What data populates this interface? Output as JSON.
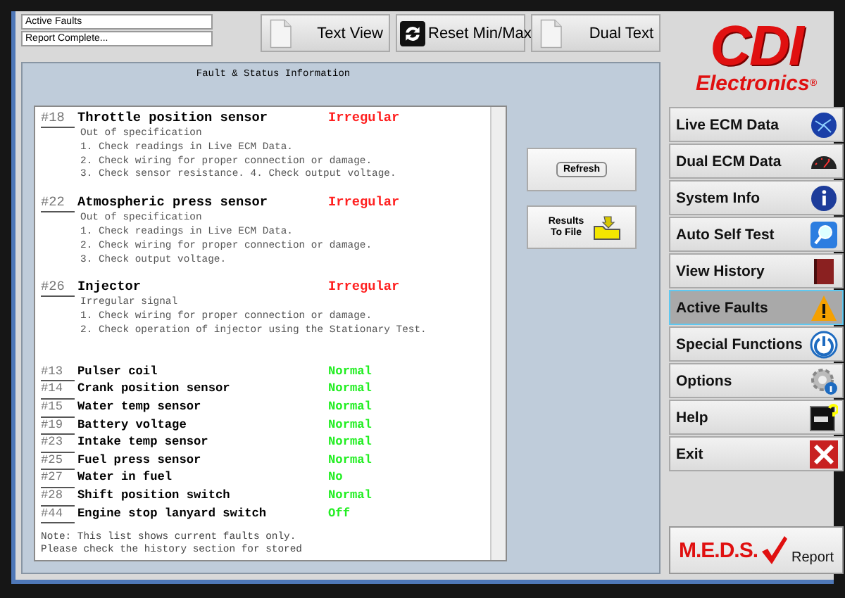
{
  "status_fields": [
    "Active Faults",
    "Report Complete..."
  ],
  "toolbar": [
    {
      "label": "Text View",
      "kind": "document"
    },
    {
      "label": "Reset Min/Max",
      "kind": "reset"
    },
    {
      "label": "Dual Text",
      "kind": "document"
    }
  ],
  "logo": {
    "brand": "CDI",
    "subtitle": "Electronics",
    "mark": "®"
  },
  "report": {
    "title": "Fault & Status Information",
    "faults": [
      {
        "code": "#18",
        "name": "Throttle position sensor",
        "status": "Irregular",
        "color": "#ff2020",
        "details": [
          "Out of specification",
          "1. Check readings in Live ECM Data.",
          "2. Check wiring for proper connection or damage.",
          "3. Check sensor resistance. 4. Check output voltage."
        ]
      },
      {
        "code": "#22",
        "name": "Atmospheric press sensor",
        "status": "Irregular",
        "color": "#ff2020",
        "details": [
          "Out of specification",
          "1. Check readings in Live ECM Data.",
          "2. Check wiring for proper connection or damage.",
          "3. Check output voltage."
        ]
      },
      {
        "code": "#26",
        "name": "Injector",
        "status": "Irregular",
        "color": "#ff2020",
        "details": [
          "Irregular signal",
          "1. Check wiring for proper connection or damage.",
          "2. Check operation of injector using the Stationary Test."
        ]
      }
    ],
    "readings": [
      {
        "code": "#13",
        "name": "Pulser coil",
        "status": "Normal",
        "color": "#22ee22"
      },
      {
        "code": "#14",
        "name": "Crank position sensor",
        "status": "Normal",
        "color": "#22ee22"
      },
      {
        "code": "#15",
        "name": "Water temp sensor",
        "status": "Normal",
        "color": "#22ee22"
      },
      {
        "code": "#19",
        "name": "Battery voltage",
        "status": "Normal",
        "color": "#22ee22"
      },
      {
        "code": "#23",
        "name": "Intake temp sensor",
        "status": "Normal",
        "color": "#22ee22"
      },
      {
        "code": "#25",
        "name": "Fuel press sensor",
        "status": "Normal",
        "color": "#22ee22"
      },
      {
        "code": "#27",
        "name": "Water in fuel",
        "status": "No",
        "color": "#22ee22"
      },
      {
        "code": "#28",
        "name": "Shift position switch",
        "status": "Normal",
        "color": "#22ee22"
      },
      {
        "code": "#44",
        "name": "Engine stop lanyard switch",
        "status": "Off",
        "color": "#22ee22"
      }
    ],
    "note": [
      "Note: This list shows current faults only.",
      "Please check the history section for stored"
    ]
  },
  "actions": [
    {
      "label": "Refresh",
      "kind": "refresh"
    },
    {
      "label": "Results To File",
      "kind": "file"
    }
  ],
  "sidebar": {
    "items": [
      {
        "label": "Live ECM Data",
        "selected": false
      },
      {
        "label": "Dual ECM Data",
        "selected": false
      },
      {
        "label": "System Info",
        "selected": false
      },
      {
        "label": "Auto Self Test",
        "selected": false
      },
      {
        "label": "View History",
        "selected": false
      },
      {
        "label": "Active Faults",
        "selected": true
      },
      {
        "label": "Special Functions",
        "selected": false
      },
      {
        "label": "Options",
        "selected": false
      },
      {
        "label": "Help",
        "selected": false
      },
      {
        "label": "Exit",
        "selected": false
      }
    ]
  },
  "meds": {
    "brand": "M.E.D.S.",
    "label": "Report"
  }
}
